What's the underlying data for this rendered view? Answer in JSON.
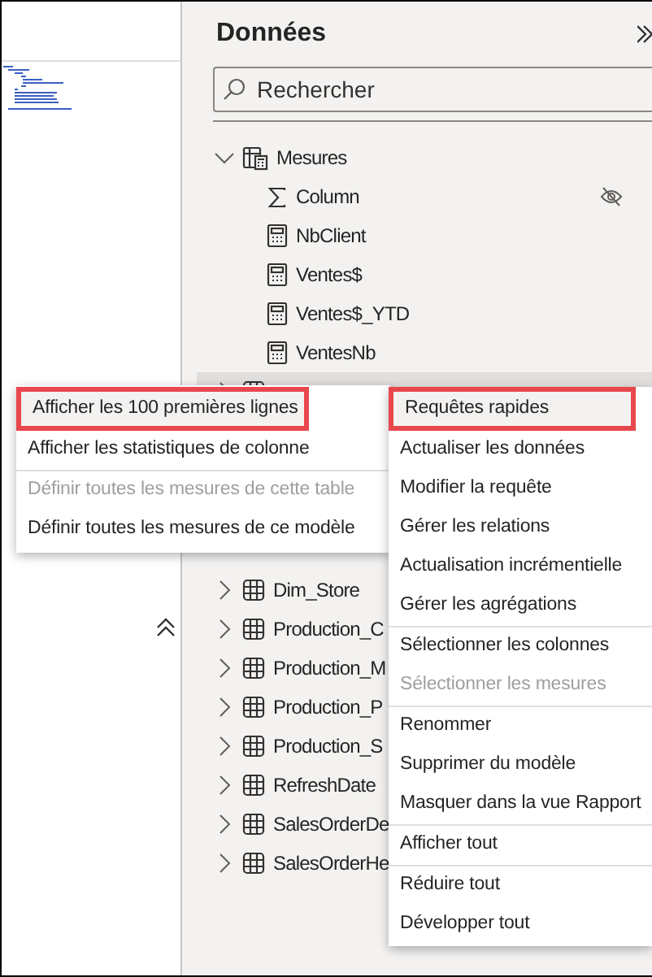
{
  "panel": {
    "title": "Données",
    "search": {
      "placeholder": "Rechercher"
    }
  },
  "tree": [
    {
      "name": "Mesures",
      "kind": "measure-table",
      "expanded": true,
      "children": [
        {
          "name": "Column",
          "kind": "sum",
          "hidden": true
        },
        {
          "name": "NbClient",
          "kind": "measure",
          "hidden": false
        },
        {
          "name": "Ventes$",
          "kind": "measure",
          "hidden": false
        },
        {
          "name": "Ventes$_YTD",
          "kind": "measure",
          "hidden": false
        },
        {
          "name": "VentesNb",
          "kind": "measure",
          "hidden": false
        }
      ]
    },
    {
      "kind": "table",
      "expanded": false,
      "hovered": true
    }
  ],
  "lower_tables": [
    {
      "name": "Dim_Store",
      "kind": "table",
      "expanded": false
    },
    {
      "name": "Production_C",
      "kind": "table",
      "expanded": false
    },
    {
      "name": "Production_M",
      "kind": "table",
      "expanded": false
    },
    {
      "name": "Production_P",
      "kind": "table",
      "expanded": false
    },
    {
      "name": "Production_S",
      "kind": "table",
      "expanded": false
    },
    {
      "name": "RefreshDate",
      "kind": "table",
      "expanded": false
    },
    {
      "name": "SalesOrderDe",
      "kind": "table",
      "expanded": false
    },
    {
      "name": "SalesOrderHe",
      "kind": "table",
      "expanded": false
    }
  ],
  "submenu": [
    {
      "label": "Afficher les 100 premières lignes",
      "disabled": false,
      "outlined": true,
      "separator_before": false
    },
    {
      "label": "Afficher les statistiques de colonne",
      "disabled": false,
      "outlined": false,
      "separator_before": false
    },
    {
      "label": "Définir toutes les mesures de cette table",
      "disabled": true,
      "outlined": false,
      "separator_before": true
    },
    {
      "label": "Définir toutes les mesures de ce modèle",
      "disabled": false,
      "outlined": false,
      "separator_before": false
    }
  ],
  "context_menu": [
    {
      "label": "Requêtes rapides",
      "disabled": false,
      "outlined": true,
      "separator_before": false
    },
    {
      "label": "Actualiser les données",
      "disabled": false,
      "outlined": false,
      "separator_before": false
    },
    {
      "label": "Modifier la requête",
      "disabled": false,
      "outlined": false,
      "separator_before": false
    },
    {
      "label": "Gérer les relations",
      "disabled": false,
      "outlined": false,
      "separator_before": false
    },
    {
      "label": "Actualisation incrémentielle",
      "disabled": false,
      "outlined": false,
      "separator_before": false
    },
    {
      "label": "Gérer les agrégations",
      "disabled": false,
      "outlined": false,
      "separator_before": false
    },
    {
      "label": "Sélectionner les colonnes",
      "disabled": false,
      "outlined": false,
      "separator_before": true
    },
    {
      "label": "Sélectionner les mesures",
      "disabled": true,
      "outlined": false,
      "separator_before": false
    },
    {
      "label": "Renommer",
      "disabled": false,
      "outlined": false,
      "separator_before": true
    },
    {
      "label": "Supprimer du modèle",
      "disabled": false,
      "outlined": false,
      "separator_before": false
    },
    {
      "label": "Masquer dans la vue Rapport",
      "disabled": false,
      "outlined": false,
      "separator_before": false
    },
    {
      "label": "Afficher tout",
      "disabled": false,
      "outlined": false,
      "separator_before": true
    },
    {
      "label": "Réduire tout",
      "disabled": false,
      "outlined": false,
      "separator_before": true
    },
    {
      "label": "Développer tout",
      "disabled": false,
      "outlined": false,
      "separator_before": false
    }
  ]
}
